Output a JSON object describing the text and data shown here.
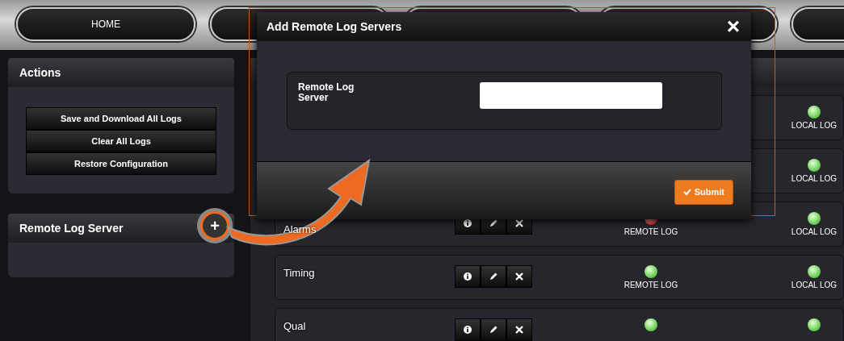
{
  "nav": {
    "tabs": [
      {
        "label": "HOME"
      }
    ]
  },
  "sidebar": {
    "panels": [
      {
        "title": "Actions",
        "buttons": [
          "Save and Download All Logs",
          "Clear All Logs",
          "Restore Configuration"
        ]
      },
      {
        "title": "Remote Log Server",
        "add_button": "+"
      }
    ]
  },
  "log_list": {
    "rows": [
      {
        "local_label": "LOCAL LOG",
        "local_ok": true
      },
      {
        "local_label": "LOCAL LOG",
        "local_ok": true
      },
      {
        "name": "Alarms",
        "remote_label": "REMOTE LOG",
        "remote_ok": false,
        "local_label": "LOCAL LOG",
        "local_ok": true
      },
      {
        "name": "Timing",
        "remote_label": "REMOTE LOG",
        "remote_ok": true,
        "local_label": "LOCAL LOG",
        "local_ok": true
      },
      {
        "name": "Qual",
        "remote_ok": true,
        "local_ok": true
      }
    ]
  },
  "modal": {
    "title": "Add Remote Log Servers",
    "close": "×",
    "field": {
      "label": "Remote Log Server"
    },
    "submit": "Submit"
  }
}
